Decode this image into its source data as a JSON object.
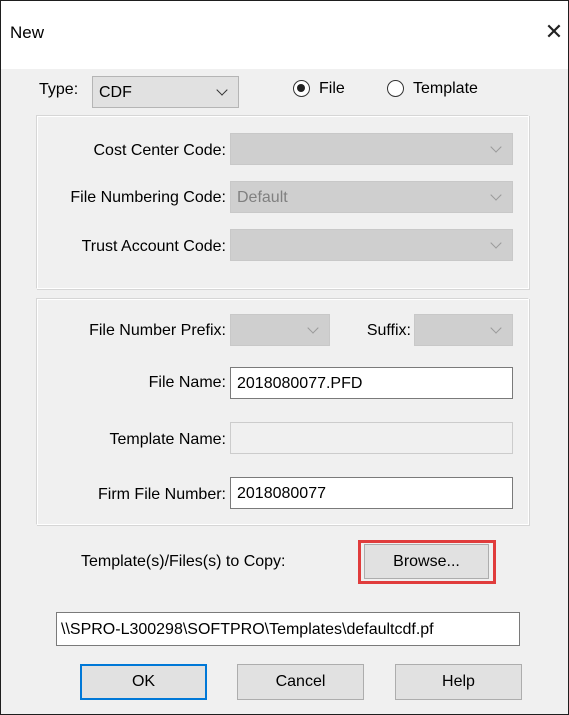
{
  "window": {
    "title": "New",
    "close_glyph": "✕"
  },
  "type": {
    "label": "Type:",
    "value": "CDF"
  },
  "mode": {
    "file_label": "File",
    "template_label": "Template",
    "selected": "File"
  },
  "codes": {
    "cost_center_label": "Cost Center Code:",
    "cost_center_value": "",
    "file_numbering_label": "File Numbering Code:",
    "file_numbering_value": "Default",
    "trust_account_label": "Trust Account Code:",
    "trust_account_value": ""
  },
  "file": {
    "prefix_label": "File Number Prefix:",
    "prefix_value": "",
    "suffix_label": "Suffix:",
    "suffix_value": "",
    "file_name_label": "File Name:",
    "file_name_value": "2018080077.PFD",
    "template_name_label": "Template Name:",
    "template_name_value": "",
    "firm_file_number_label": "Firm File Number:",
    "firm_file_number_value": "2018080077"
  },
  "copy": {
    "label": "Template(s)/Files(s) to Copy:",
    "browse_label": "Browse...",
    "path_value": "\\\\SPRO-L300298\\SOFTPRO\\Templates\\defaultcdf.pf"
  },
  "buttons": {
    "ok": "OK",
    "cancel": "Cancel",
    "help": "Help"
  },
  "colors": {
    "accent": "#0078d7",
    "highlight": "#e03c3c"
  }
}
